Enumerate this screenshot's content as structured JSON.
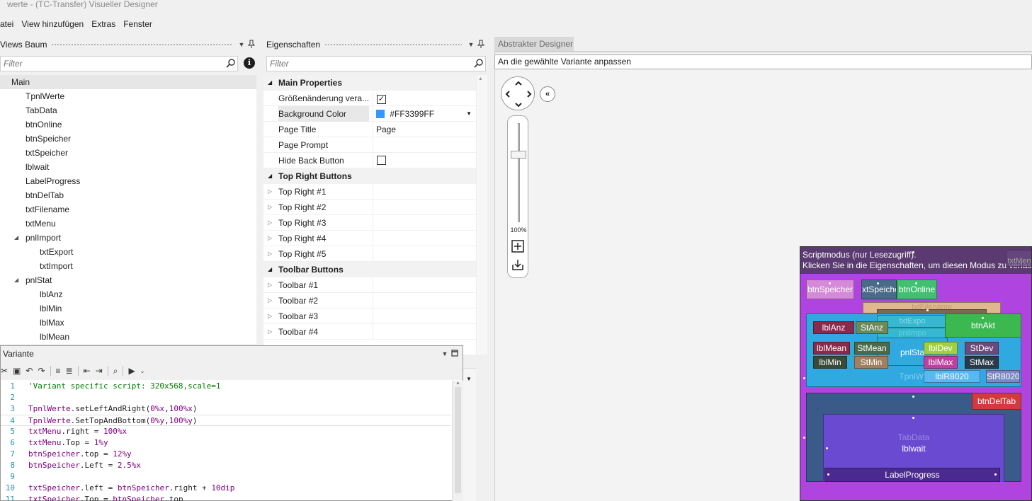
{
  "window": {
    "title": "werte - (TC-Transfer) Visueller Designer"
  },
  "menu": [
    "atei",
    "View hinzufügen",
    "Extras",
    "Fenster"
  ],
  "views_tree": {
    "title": "Views Baum",
    "filter_placeholder": "Filter",
    "items": [
      {
        "label": "Main",
        "level": 0,
        "selected": true
      },
      {
        "label": "TpnlWerte",
        "level": 1
      },
      {
        "label": "TabData",
        "level": 1
      },
      {
        "label": "btnOnline",
        "level": 1
      },
      {
        "label": "btnSpeicher",
        "level": 1
      },
      {
        "label": "txtSpeicher",
        "level": 1
      },
      {
        "label": "lblwait",
        "level": 1
      },
      {
        "label": "LabelProgress",
        "level": 1
      },
      {
        "label": "btnDelTab",
        "level": 1
      },
      {
        "label": "txtFilename",
        "level": 1
      },
      {
        "label": "txtMenu",
        "level": 1
      },
      {
        "label": "pnlImport",
        "level": 1,
        "expanded": true
      },
      {
        "label": "txtExport",
        "level": 2
      },
      {
        "label": "txtImport",
        "level": 2
      },
      {
        "label": "pnlStat",
        "level": 1,
        "expanded": true
      },
      {
        "label": "lblAnz",
        "level": 2
      },
      {
        "label": "lblMin",
        "level": 2
      },
      {
        "label": "lblMax",
        "level": 2
      },
      {
        "label": "lblMean",
        "level": 2
      }
    ]
  },
  "properties": {
    "title": "Eigenschaften",
    "filter_placeholder": "Filter",
    "main_cat": "Main Properties",
    "resize_label": "Größenänderung vera...",
    "bg_label": "Background Color",
    "bg_value": "#FF3399FF",
    "bg_swatch": "#3399ff",
    "title_label": "Page Title",
    "title_value": "Page",
    "prompt_label": "Page Prompt",
    "hideback_label": "Hide Back Button",
    "topright_cat": "Top Right Buttons",
    "topright": [
      "Top Right #1",
      "Top Right #2",
      "Top Right #3",
      "Top Right #4",
      "Top Right #5"
    ],
    "toolbar_cat": "Toolbar Buttons",
    "toolbar": [
      "Toolbar #1",
      "Toolbar #2",
      "Toolbar #3",
      "Toolbar #4"
    ]
  },
  "designer": {
    "tab": "Abstrakter Designer",
    "variant_text": "An die gewählte Variante anpassen",
    "zoom": "100%"
  },
  "variante": {
    "title": "Variante",
    "code": [
      "'Variant specific script: 320x568,scale=1",
      "",
      "TpnlWerte.setLeftAndRight(0%x,100%x)",
      "TpnlWerte.SetTopAndBottom(0%y,100%y)",
      "txtMenu.right = 100%x",
      "txtMenu.Top = 1%y",
      "btnSpeicher.top = 12%y",
      "btnSpeicher.Left = 2.5%x",
      "",
      "txtSpeicher.left = btnSpeicher.right + 10dip",
      "txtSpeicher.Top = btnSpeicher.top"
    ]
  },
  "phone": {
    "header1": "Scriptmodus (nur Lesezugriff).",
    "header2": "Klicken Sie in die Eigenschaften, um diesen Modus zu verlassen.",
    "txtMenu": "txtMen",
    "btnSpeicher": "btnSpeicher",
    "txtSpeicher": "xtSpeiche",
    "btnOnline": "btnOnline",
    "txtFilename": "txtFilename",
    "txtExport": "txtExpo",
    "txtImport": "pnlImpo",
    "btnAkt": "btnAkt",
    "lblAnz": "lblAnz",
    "StAnz": "StAnz",
    "lblMean": "lblMean",
    "StMean": "StMean",
    "pnlStat": "pnlSta",
    "lblDev": "lblDev",
    "StDev": "StDev",
    "lblMin": "lblMin",
    "StMin": "StMin",
    "lblMax": "lblMax",
    "StMax": "StMax",
    "lblR8020": "lblR8020",
    "StR8020": "StR8020",
    "TpnlWerte": "TpnlWe",
    "btnDelTab": "btnDelTab",
    "TabData": "TabData",
    "lblwait": "lblwait",
    "LabelProgress": "LabelProgress"
  }
}
